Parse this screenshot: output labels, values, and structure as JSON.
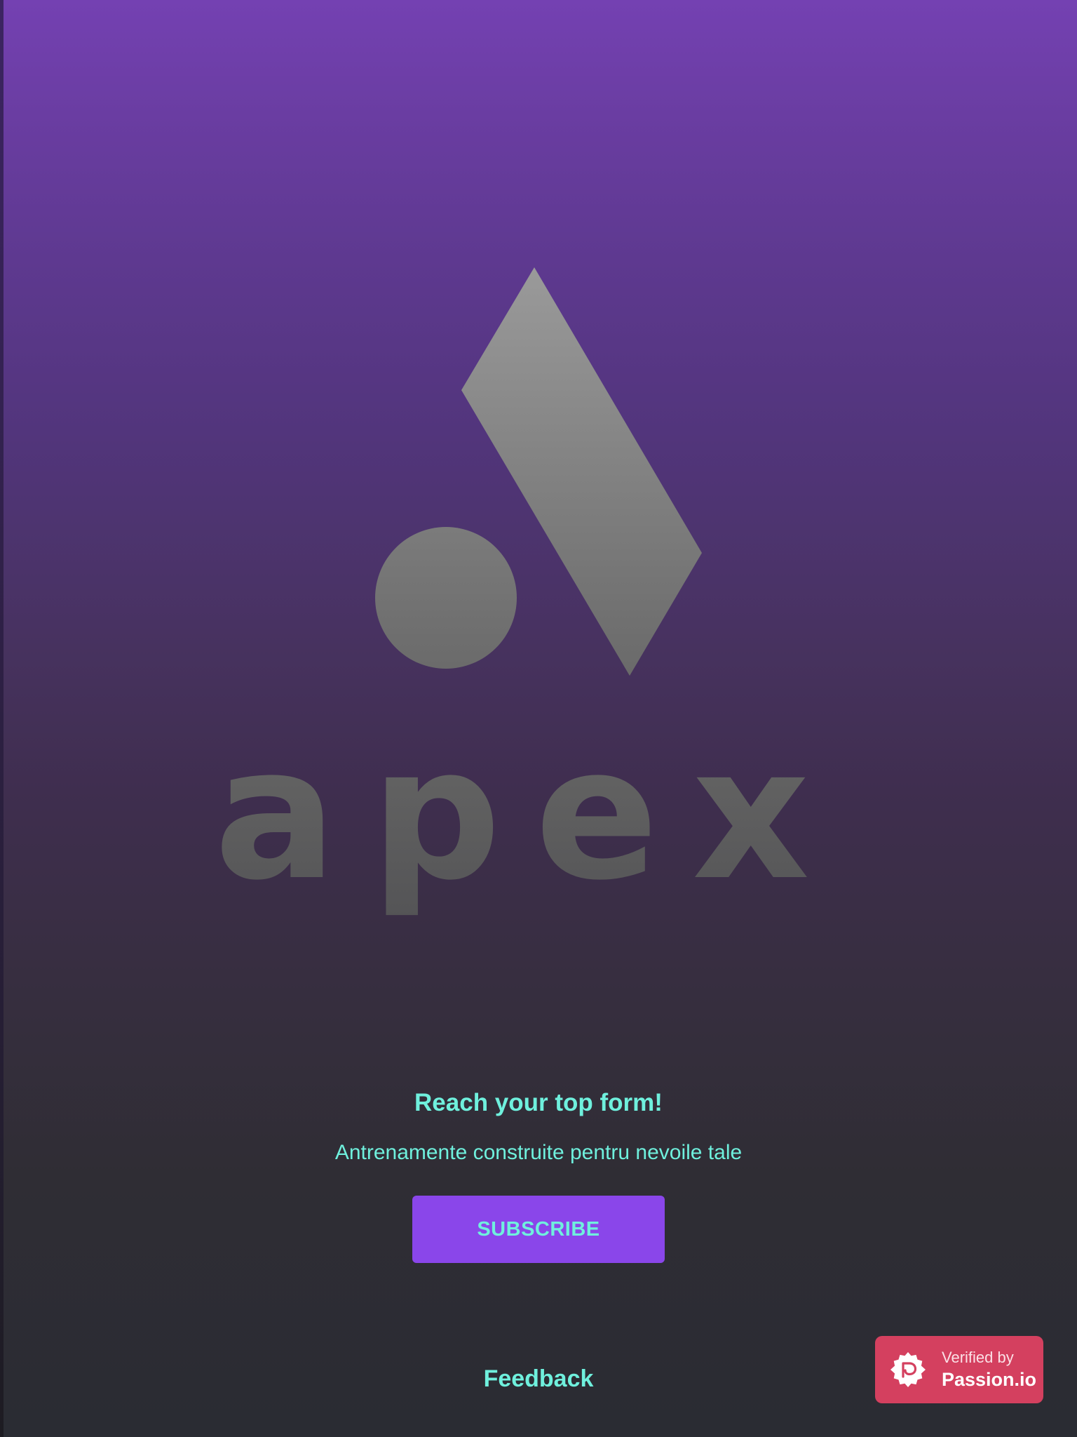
{
  "logo": {
    "icon_name": "apex-logo",
    "wordmark": "apex",
    "color_top": "#9a9a9a",
    "color_bottom": "#5e5e5e"
  },
  "hero": {
    "headline": "Reach your top form!",
    "subline": "Antrenamente construite pentru nevoile tale"
  },
  "cta": {
    "subscribe_label": "SUBSCRIBE"
  },
  "footer": {
    "feedback_label": "Feedback"
  },
  "badge": {
    "icon_name": "passion-seal-icon",
    "line1": "Verified by",
    "line2": "Passion.io"
  },
  "colors": {
    "accent_text": "#6ff0dd",
    "button_bg": "#8a46ea",
    "badge_bg": "#d4405f",
    "gradient_top": "#7441b2",
    "gradient_bottom": "#2a2c33"
  }
}
